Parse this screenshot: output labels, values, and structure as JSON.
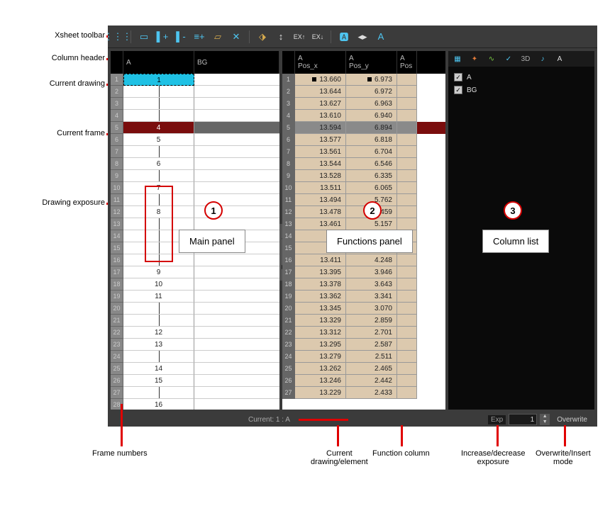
{
  "annotations": {
    "toolbar": "Xsheet toolbar",
    "col_header": "Column header",
    "current_drawing": "Current drawing",
    "current_frame": "Current frame",
    "drawing_exposure": "Drawing exposure",
    "frame_numbers": "Frame numbers",
    "current_element": "Current\ndrawing/element",
    "function_column": "Function column",
    "exposure_ctrl": "Increase/decrease\nexposure",
    "mode": "Overwrite/Insert\nmode"
  },
  "panel_labels": {
    "p1": "Main panel",
    "p2": "Functions panel",
    "p3": "Column list"
  },
  "headers": {
    "main": {
      "a": "A",
      "bg": "BG"
    },
    "func": {
      "a1": "A",
      "posx": "Pos_x",
      "a2": "A",
      "posy": "Pos_y",
      "a3": "A",
      "pos3": "Pos"
    }
  },
  "main_rows": [
    {
      "n": 1,
      "v": "1",
      "cd": true
    },
    {
      "n": 2,
      "v": "",
      "tick": true
    },
    {
      "n": 3,
      "v": "",
      "tick": true
    },
    {
      "n": 4,
      "v": "",
      "tick": true
    },
    {
      "n": 5,
      "v": "4",
      "cf": true
    },
    {
      "n": 6,
      "v": "5"
    },
    {
      "n": 7,
      "v": "",
      "tick": true
    },
    {
      "n": 8,
      "v": "6"
    },
    {
      "n": 9,
      "v": "",
      "tick": true
    },
    {
      "n": 10,
      "v": "7"
    },
    {
      "n": 11,
      "v": "",
      "tick": true
    },
    {
      "n": 12,
      "v": "8"
    },
    {
      "n": 13,
      "v": "",
      "tick": true
    },
    {
      "n": 14,
      "v": "",
      "tick": true
    },
    {
      "n": 15,
      "v": "",
      "tick": true
    },
    {
      "n": 16,
      "v": "",
      "tick": true
    },
    {
      "n": 17,
      "v": "9"
    },
    {
      "n": 18,
      "v": "10"
    },
    {
      "n": 19,
      "v": "11"
    },
    {
      "n": 20,
      "v": "",
      "tick": true
    },
    {
      "n": 21,
      "v": "",
      "tick": true
    },
    {
      "n": 22,
      "v": "12"
    },
    {
      "n": 23,
      "v": "13"
    },
    {
      "n": 24,
      "v": "",
      "tick": true
    },
    {
      "n": 25,
      "v": "14"
    },
    {
      "n": 26,
      "v": "15"
    },
    {
      "n": 27,
      "v": "",
      "tick": true
    },
    {
      "n": 28,
      "v": "16"
    }
  ],
  "func_rows": [
    {
      "n": 1,
      "x": "13.660",
      "y": "6.973",
      "kf": true
    },
    {
      "n": 2,
      "x": "13.644",
      "y": "6.972"
    },
    {
      "n": 3,
      "x": "13.627",
      "y": "6.963"
    },
    {
      "n": 4,
      "x": "13.610",
      "y": "6.940"
    },
    {
      "n": 5,
      "x": "13.594",
      "y": "6.894",
      "cf": true
    },
    {
      "n": 6,
      "x": "13.577",
      "y": "6.818"
    },
    {
      "n": 7,
      "x": "13.561",
      "y": "6.704"
    },
    {
      "n": 8,
      "x": "13.544",
      "y": "6.546"
    },
    {
      "n": 9,
      "x": "13.528",
      "y": "6.335"
    },
    {
      "n": 10,
      "x": "13.511",
      "y": "6.065"
    },
    {
      "n": 11,
      "x": "13.494",
      "y": "5.762"
    },
    {
      "n": 12,
      "x": "13.478",
      "y": "5.459"
    },
    {
      "n": 13,
      "x": "13.461",
      "y": "5.157"
    },
    {
      "n": 14,
      "x": "",
      "y": ""
    },
    {
      "n": 15,
      "x": "",
      "y": ""
    },
    {
      "n": 16,
      "x": "13.411",
      "y": "4.248"
    },
    {
      "n": 17,
      "x": "13.395",
      "y": "3.946"
    },
    {
      "n": 18,
      "x": "13.378",
      "y": "3.643"
    },
    {
      "n": 19,
      "x": "13.362",
      "y": "3.341"
    },
    {
      "n": 20,
      "x": "13.345",
      "y": "3.070"
    },
    {
      "n": 21,
      "x": "13.329",
      "y": "2.859"
    },
    {
      "n": 22,
      "x": "13.312",
      "y": "2.701"
    },
    {
      "n": 23,
      "x": "13.295",
      "y": "2.587"
    },
    {
      "n": 24,
      "x": "13.279",
      "y": "2.511"
    },
    {
      "n": 25,
      "x": "13.262",
      "y": "2.465"
    },
    {
      "n": 26,
      "x": "13.246",
      "y": "2.442"
    },
    {
      "n": 27,
      "x": "13.229",
      "y": "2.433"
    }
  ],
  "column_list": [
    "A",
    "BG"
  ],
  "status": {
    "current": "Current: 1 : A",
    "exp_label": "Exp",
    "exp_value": "1",
    "mode": "Overwrite"
  },
  "p3_tabs": [
    "▦",
    "✦",
    "∿",
    "✓",
    "3D",
    "♪",
    "A"
  ]
}
